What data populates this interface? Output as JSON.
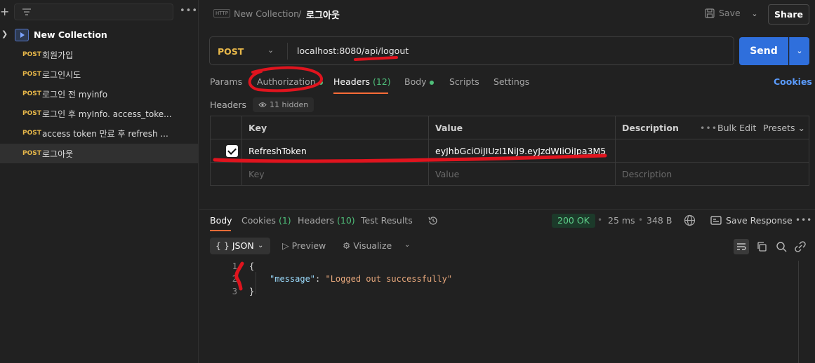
{
  "sidebar": {
    "collection_name": "New Collection",
    "requests": [
      {
        "method": "POST",
        "name": "회원가입"
      },
      {
        "method": "POST",
        "name": "로그인시도"
      },
      {
        "method": "POST",
        "name": "로그인 전 myinfo"
      },
      {
        "method": "POST",
        "name": "로그인 후 myInfo. access_toke..."
      },
      {
        "method": "POST",
        "name": "access token 만료 후 refresh ..."
      },
      {
        "method": "POST",
        "name": "로그아웃"
      }
    ]
  },
  "header": {
    "tab_icon": "HTTP",
    "breadcrumb_collection": "New Collection",
    "breadcrumb_sep": "/",
    "breadcrumb_request": "로그아웃",
    "save_label": "Save",
    "share_label": "Share"
  },
  "request": {
    "method": "POST",
    "url": "localhost:8080/api/logout",
    "send_label": "Send",
    "tabs": {
      "params": "Params",
      "authorization": "Authorization",
      "headers": "Headers",
      "headers_count": "(12)",
      "body": "Body",
      "scripts": "Scripts",
      "settings": "Settings"
    },
    "cookies_label": "Cookies",
    "headers_label": "Headers",
    "hidden_label": "11 hidden"
  },
  "headers_table": {
    "columns": {
      "key": "Key",
      "value": "Value",
      "description": "Description"
    },
    "bulk_edit": "Bulk Edit",
    "presets": "Presets",
    "rows": [
      {
        "key": "RefreshToken",
        "value": "eyJhbGciOiJIUzI1NiJ9.eyJzdWIiOiJpa3M5"
      }
    ],
    "placeholder": {
      "key": "Key",
      "value": "Value",
      "description": "Description"
    }
  },
  "response": {
    "tabs": {
      "body": "Body",
      "cookies": "Cookies",
      "cookies_count": "(1)",
      "headers": "Headers",
      "headers_count": "(10)",
      "test_results": "Test Results"
    },
    "status": "200 OK",
    "time": "25 ms",
    "size": "348 B",
    "save_response": "Save Response",
    "format": "JSON",
    "preview": "Preview",
    "visualize": "Visualize",
    "lines": [
      "1",
      "2",
      "3"
    ],
    "code": {
      "open": "{",
      "key": "\"message\"",
      "colon": ": ",
      "value": "\"Logged out successfully\"",
      "close": "}"
    }
  },
  "colors": {
    "accent": "#ff6c37",
    "send": "#2f6fdc",
    "method_post": "#e8b84a",
    "status_ok": "#5ed08a",
    "annotation": "#e0141e"
  }
}
